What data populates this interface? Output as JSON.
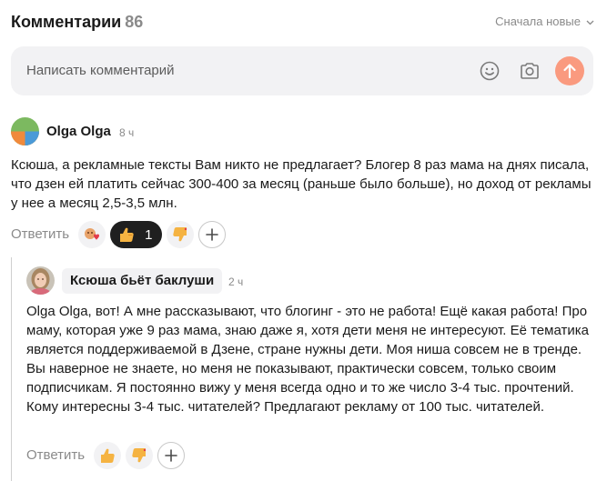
{
  "header": {
    "title": "Комментарии",
    "count": "86",
    "sort_label": "Сначала новые"
  },
  "composer": {
    "placeholder": "Написать комментарий"
  },
  "comments": [
    {
      "author": "Olga Olga",
      "time": "8 ч",
      "text": "Ксюша, а рекламные тексты Вам никто не предлагает? Блогер 8 раз мама на днях писала, что дзен ей платить сейчас 300-400 за месяц (раньше было больше), но доход от рекламы у нее а месяц 2,5-3,5 млн.",
      "reply_label": "Ответить",
      "like_count": "1"
    },
    {
      "author": "Ксюша бьёт баклуши",
      "time": "2 ч",
      "text": "Olga Olga, вот! А мне рассказывают, что блогинг - это не работа! Ещё какая работа! Про маму, которая уже 9 раз мама, знаю даже я, хотя дети меня не интересуют. Её тематика является поддерживаемой в Дзене, стране нужны дети. Моя ниша совсем не в тренде. Вы наверное не знаете, но меня не показывают, практически совсем, только своим подписчикам. Я постоянно вижу у меня всегда одно и то же число 3-4 тыс. прочтений. Кому интересны 3-4 тыс. читателей? Предлагают рекламу от 100 тыс. читателей.",
      "reply_label": "Ответить"
    }
  ],
  "colors": {
    "send_button": "#fa9a7f",
    "active_reaction": "#1f1f1f",
    "muted_text": "#8a8a8a",
    "surface": "#f2f2f4"
  },
  "icons": [
    "chevron-down-icon",
    "emoji-icon",
    "camera-icon",
    "send-arrow-icon",
    "thumbs-up-icon",
    "thumbs-down-icon",
    "plus-icon",
    "reaction-heart-icon"
  ]
}
